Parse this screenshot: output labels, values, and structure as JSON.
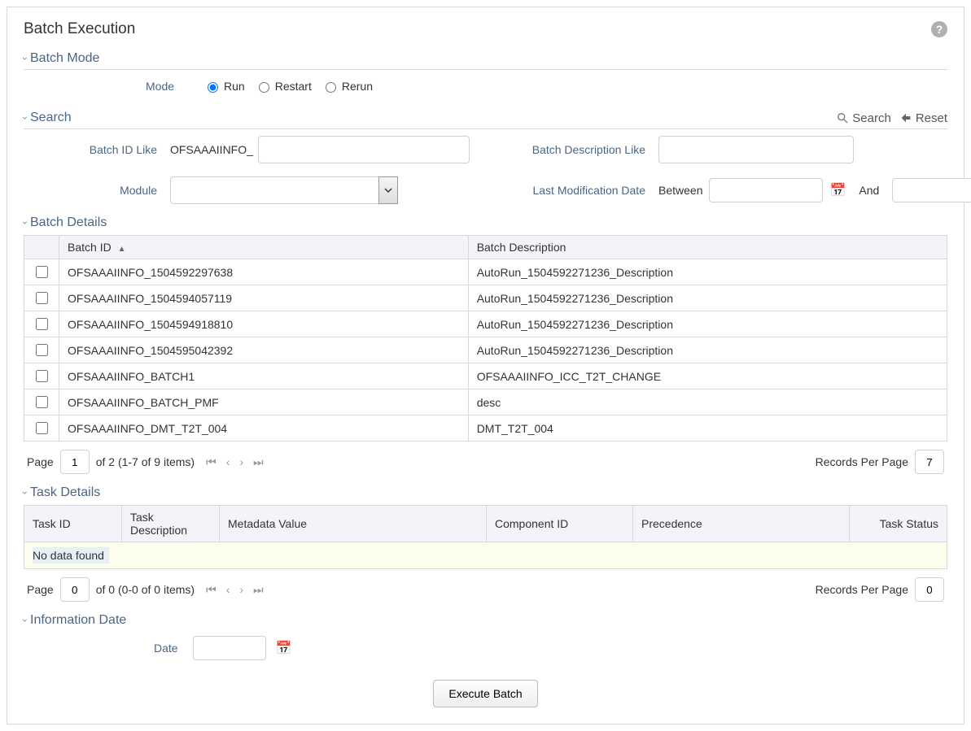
{
  "page_title": "Batch Execution",
  "sections": {
    "batch_mode": {
      "title": "Batch Mode",
      "mode_label": "Mode",
      "options": {
        "run": "Run",
        "restart": "Restart",
        "rerun": "Rerun"
      },
      "selected": "run"
    },
    "search": {
      "title": "Search",
      "actions": {
        "search": "Search",
        "reset": "Reset"
      },
      "fields": {
        "batch_id_like_label": "Batch ID Like",
        "batch_id_like_prefix": "OFSAAAIINFO_",
        "batch_id_like_value": "",
        "batch_desc_like_label": "Batch Description Like",
        "batch_desc_like_value": "",
        "module_label": "Module",
        "module_value": "",
        "last_mod_label": "Last Modification Date",
        "between_label": "Between",
        "and_label": "And",
        "date_from": "",
        "date_to": ""
      }
    },
    "batch_details": {
      "title": "Batch Details",
      "columns": {
        "id": "Batch ID",
        "desc": "Batch Description"
      },
      "rows": [
        {
          "id": "OFSAAAIINFO_1504592297638",
          "desc": "AutoRun_1504592271236_Description"
        },
        {
          "id": "OFSAAAIINFO_1504594057119",
          "desc": "AutoRun_1504592271236_Description"
        },
        {
          "id": "OFSAAAIINFO_1504594918810",
          "desc": "AutoRun_1504592271236_Description"
        },
        {
          "id": "OFSAAAIINFO_1504595042392",
          "desc": "AutoRun_1504592271236_Description"
        },
        {
          "id": "OFSAAAIINFO_BATCH1",
          "desc": "OFSAAAIINFO_ICC_T2T_CHANGE"
        },
        {
          "id": "OFSAAAIINFO_BATCH_PMF",
          "desc": "desc"
        },
        {
          "id": "OFSAAAIINFO_DMT_T2T_004",
          "desc": "DMT_T2T_004"
        }
      ],
      "pager": {
        "page_label": "Page",
        "page": "1",
        "of_text": "of 2 (1-7 of 9 items)",
        "rpp_label": "Records Per Page",
        "rpp": "7"
      }
    },
    "task_details": {
      "title": "Task Details",
      "columns": {
        "task_id": "Task ID",
        "task_desc": "Task Description",
        "metadata": "Metadata Value",
        "component": "Component ID",
        "precedence": "Precedence",
        "status": "Task Status"
      },
      "no_data": "No data found",
      "pager": {
        "page_label": "Page",
        "page": "0",
        "of_text": "of 0 (0-0 of 0 items)",
        "rpp_label": "Records Per Page",
        "rpp": "0"
      }
    },
    "info_date": {
      "title": "Information Date",
      "date_label": "Date",
      "date_value": ""
    }
  },
  "buttons": {
    "execute": "Execute Batch"
  }
}
